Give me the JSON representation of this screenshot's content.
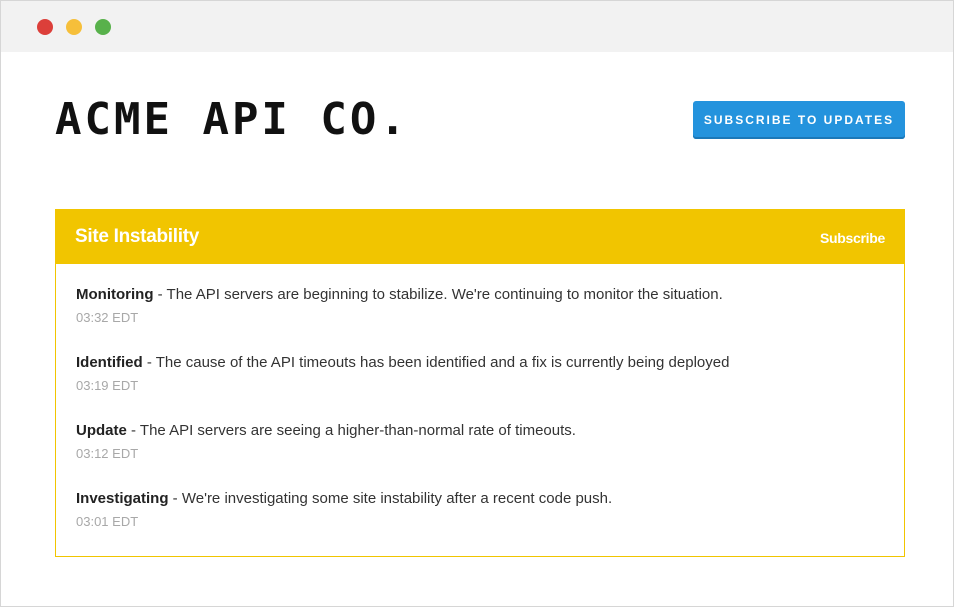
{
  "window": {
    "controls": [
      {
        "name": "close",
        "color": "#dc3f3a"
      },
      {
        "name": "minimize",
        "color": "#f6bf3a"
      },
      {
        "name": "maximize",
        "color": "#58b14b"
      }
    ]
  },
  "header": {
    "logo_text": "ACME API CO.",
    "subscribe_button_label": "SUBSCRIBE TO UPDATES"
  },
  "incident": {
    "title": "Site Instability",
    "subscribe_label": "Subscribe",
    "accent_color": "#f1c500",
    "updates": [
      {
        "status": "Monitoring",
        "message": " - The API servers are beginning to stabilize. We're continuing to monitor the situation.",
        "time": "03:32 EDT"
      },
      {
        "status": "Identified",
        "message": " - The cause of the API timeouts has been identified and a fix is currently being deployed",
        "time": "03:19 EDT"
      },
      {
        "status": "Update",
        "message": " - The API servers are seeing a higher-than-normal rate of timeouts.",
        "time": "03:12 EDT"
      },
      {
        "status": "Investigating",
        "message": " - We're investigating some site instability after a recent code push.",
        "time": "03:01 EDT"
      }
    ]
  }
}
